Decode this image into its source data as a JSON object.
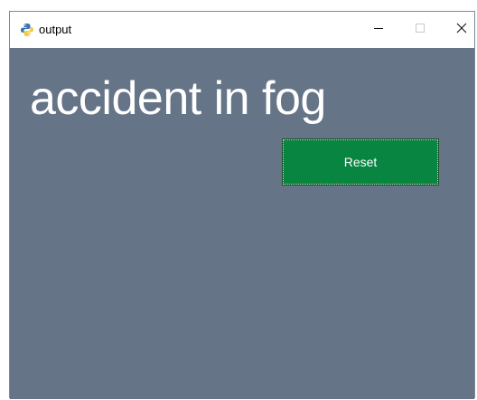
{
  "window": {
    "title": "output",
    "app_icon": "python-icon",
    "controls": {
      "minimize_icon": "minimize-icon",
      "maximize_icon": "maximize-icon",
      "close_icon": "close-icon"
    }
  },
  "main": {
    "label": "accident in fog",
    "reset_button_label": "Reset"
  },
  "colors": {
    "background": "#657487",
    "button": "#078541",
    "text": "#ffffff"
  }
}
